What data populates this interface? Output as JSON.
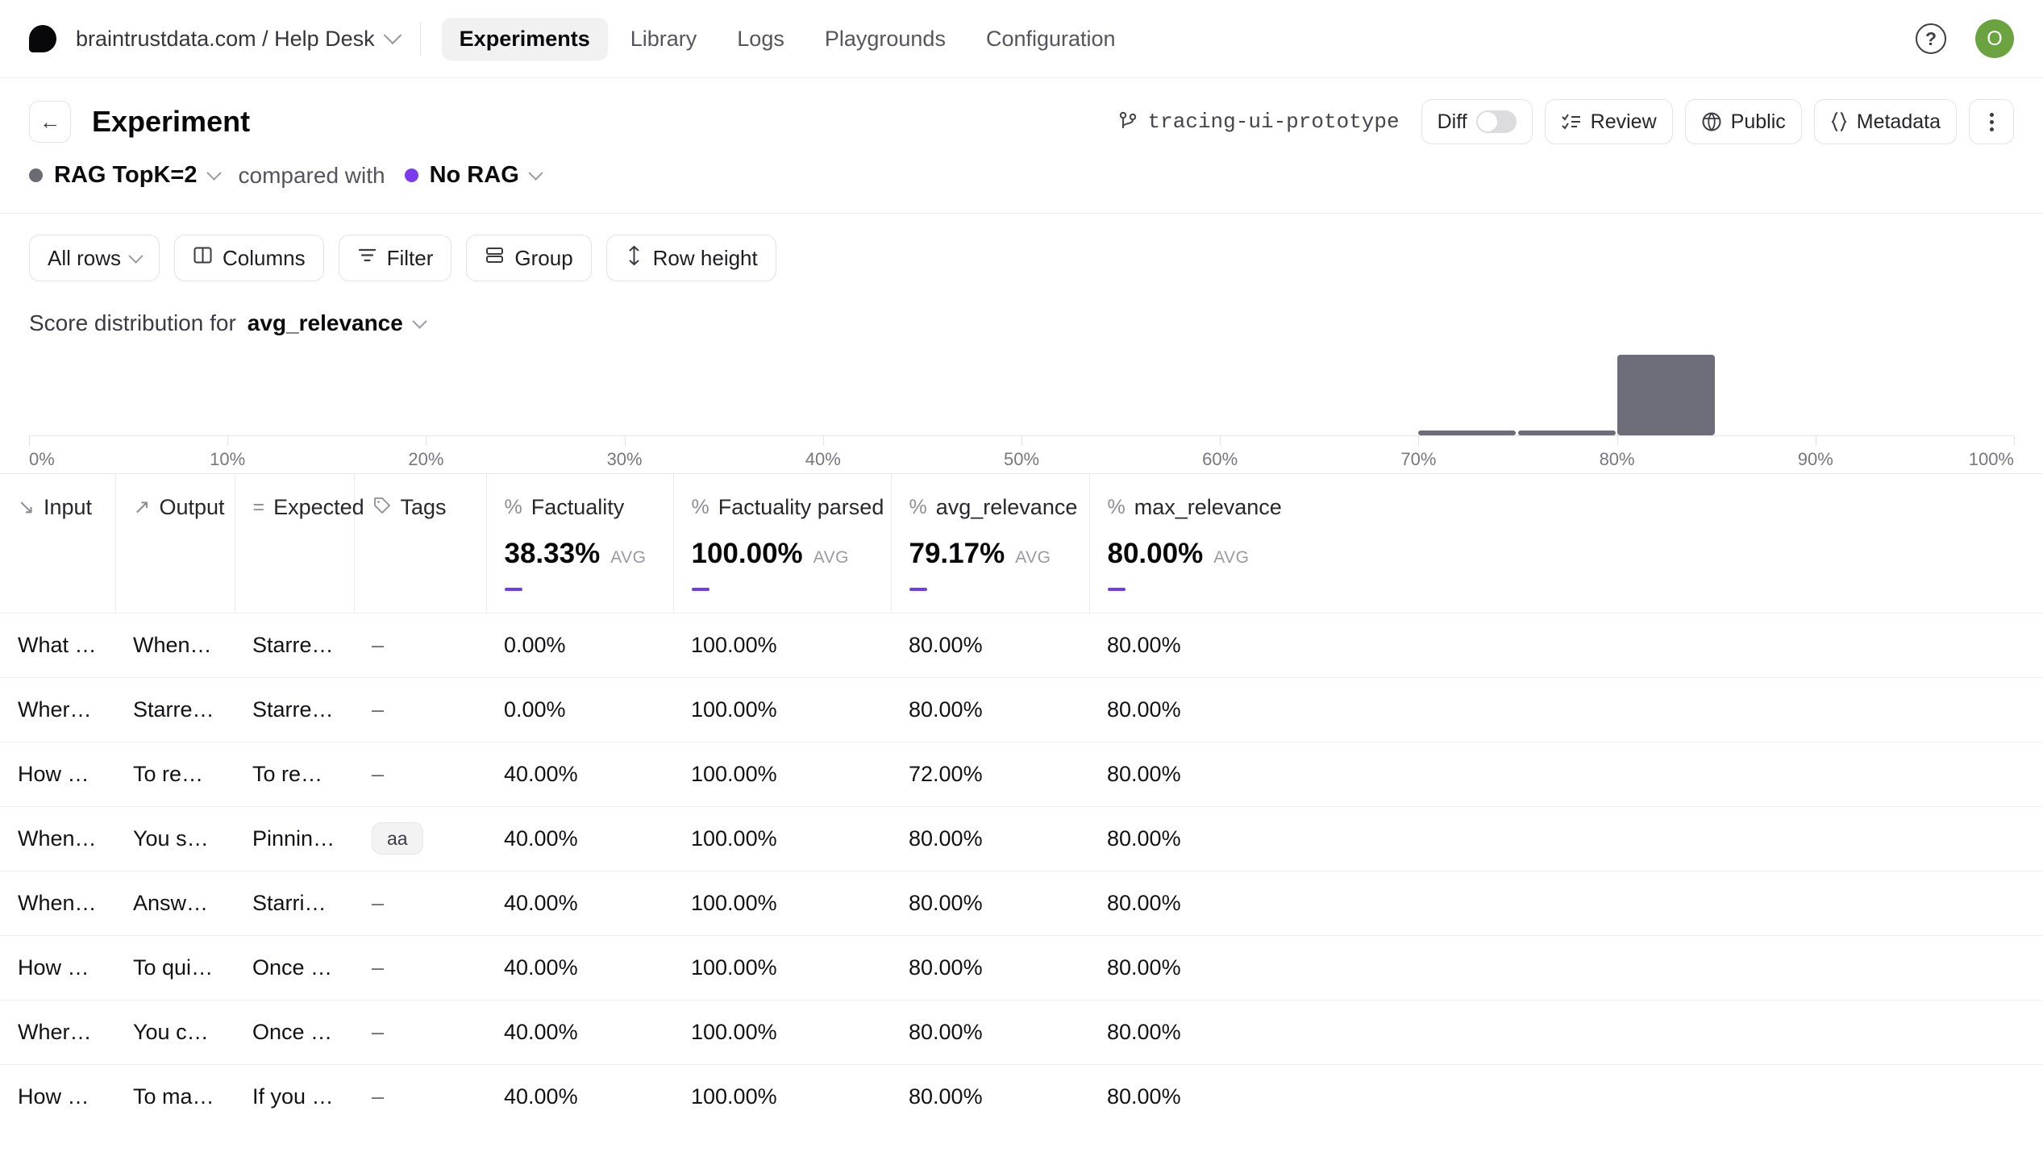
{
  "topnav": {
    "logo_icon": "braintrust-logo-icon",
    "breadcrumb": "braintrustdata.com / Help Desk",
    "breadcrumb_chevron_icon": "chevron-down-icon",
    "tabs": [
      {
        "label": "Experiments",
        "active": true
      },
      {
        "label": "Library",
        "active": false
      },
      {
        "label": "Logs",
        "active": false
      },
      {
        "label": "Playgrounds",
        "active": false
      },
      {
        "label": "Configuration",
        "active": false
      }
    ],
    "help_icon": "help-circle-icon",
    "help_glyph": "?",
    "avatar_initial": "O",
    "avatar_color": "#6aa340"
  },
  "experiment": {
    "back_icon": "arrow-left-icon",
    "back_glyph": "←",
    "title": "Experiment",
    "branch_icon": "git-branch-icon",
    "branch_name": "tracing-ui-prototype",
    "diff_label": "Diff",
    "diff_toggle_on": false,
    "review_label": "Review",
    "review_icon": "checklist-icon",
    "public_label": "Public",
    "public_icon": "globe-icon",
    "metadata_label": "Metadata",
    "metadata_icon": "braces-icon",
    "more_icon": "more-vertical-icon"
  },
  "compare": {
    "base_name": "RAG TopK=2",
    "base_color": "#6b6b74",
    "base_chevron_icon": "chevron-down-icon",
    "connector": "compared with",
    "other_name": "No RAG",
    "other_color": "#7c3aed",
    "other_chevron_icon": "chevron-down-icon"
  },
  "filterbar": {
    "buttons": [
      {
        "label": "All rows",
        "icon": "chevron-down-icon",
        "icon_side": "right"
      },
      {
        "label": "Columns",
        "icon": "columns-icon",
        "icon_side": "left"
      },
      {
        "label": "Filter",
        "icon": "filter-icon",
        "icon_side": "left"
      },
      {
        "label": "Group",
        "icon": "group-rows-icon",
        "icon_side": "left"
      },
      {
        "label": "Row height",
        "icon": "row-height-icon",
        "icon_side": "left"
      }
    ]
  },
  "distribution": {
    "label": "Score distribution for",
    "metric": "avg_relevance",
    "chevron_icon": "chevron-down-icon"
  },
  "chart_data": {
    "type": "bar",
    "title": "Score distribution for avg_relevance",
    "xlabel": "",
    "ylabel": "",
    "xlim": [
      0,
      100
    ],
    "ylim": [
      0,
      100
    ],
    "grid": false,
    "legend": null,
    "bar_color": "#6d6d79",
    "tick_labels": [
      "0%",
      "10%",
      "20%",
      "30%",
      "40%",
      "50%",
      "60%",
      "70%",
      "80%",
      "90%",
      "100%"
    ],
    "tick_values": [
      0,
      10,
      20,
      30,
      40,
      50,
      60,
      70,
      80,
      90,
      100
    ],
    "bins": [
      {
        "x0": 70,
        "x1": 75,
        "value": 4
      },
      {
        "x0": 75,
        "x1": 80,
        "value": 4
      },
      {
        "x0": 80,
        "x1": 85,
        "value": 100
      }
    ]
  },
  "table": {
    "columns": [
      {
        "name": "Input",
        "icon": "arrow-down-right-icon",
        "glyph": "↘",
        "metric": false
      },
      {
        "name": "Output",
        "icon": "arrow-up-right-icon",
        "glyph": "↗",
        "metric": false
      },
      {
        "name": "Expected",
        "icon": "equals-icon",
        "glyph": "=",
        "metric": false
      },
      {
        "name": "Tags",
        "icon": "tag-icon",
        "glyph": "⬡",
        "metric": false
      },
      {
        "name": "Factuality",
        "icon": "percent-icon",
        "glyph": "%",
        "metric": true,
        "value": "38.33%",
        "agg": "AVG"
      },
      {
        "name": "Factuality parsed",
        "icon": "percent-icon",
        "glyph": "%",
        "metric": true,
        "value": "100.00%",
        "agg": "AVG"
      },
      {
        "name": "avg_relevance",
        "icon": "percent-icon",
        "glyph": "%",
        "metric": true,
        "value": "79.17%",
        "agg": "AVG"
      },
      {
        "name": "max_relevance",
        "icon": "percent-icon",
        "glyph": "%",
        "metric": true,
        "value": "80.00%",
        "agg": "AVG"
      }
    ],
    "rows": [
      {
        "input": "What happens...",
        "output": "When you star...",
        "expected": "Starred docs ...",
        "tags": "–",
        "tag_chip": false,
        "factuality": "0.00%",
        "factuality_parsed": "100.00%",
        "avg_relevance": "80.00%",
        "max_relevance": "80.00%"
      },
      {
        "input": "Where do star...",
        "output": "Starred docs ...",
        "expected": "Starred docs ...",
        "tags": "–",
        "tag_chip": false,
        "factuality": "0.00%",
        "factuality_parsed": "100.00%",
        "avg_relevance": "80.00%",
        "max_relevance": "80.00%"
      },
      {
        "input": "How do I remo...",
        "output": "To remove a d...",
        "expected": "To remove a d...",
        "tags": "–",
        "tag_chip": false,
        "factuality": "40.00%",
        "factuality_parsed": "100.00%",
        "avg_relevance": "72.00%",
        "max_relevance": "80.00%"
      },
      {
        "input": "When should I...",
        "output": "You should pi...",
        "expected": "Pinning is rec...",
        "tags": "aa",
        "tag_chip": true,
        "factuality": "40.00%",
        "factuality_parsed": "100.00%",
        "avg_relevance": "80.00%",
        "max_relevance": "80.00%"
      },
      {
        "input": "When should I...",
        "output": "Answer: You s...",
        "expected": "Starring docs ...",
        "tags": "–",
        "tag_chip": false,
        "factuality": "40.00%",
        "factuality_parsed": "100.00%",
        "avg_relevance": "80.00%",
        "max_relevance": "80.00%"
      },
      {
        "input": "How do I quic...",
        "output": "To quickly fin...",
        "expected": "Once you star ...",
        "tags": "–",
        "tag_chip": false,
        "factuality": "40.00%",
        "factuality_parsed": "100.00%",
        "avg_relevance": "80.00%",
        "max_relevance": "80.00%"
      },
      {
        "input": "Where can I a...",
        "output": "You can acce...",
        "expected": "Once you star ...",
        "tags": "–",
        "tag_chip": false,
        "factuality": "40.00%",
        "factuality_parsed": "100.00%",
        "avg_relevance": "80.00%",
        "max_relevance": "80.00%"
      },
      {
        "input": "How can I ma...",
        "output": "To make short...",
        "expected": "If you want to ...",
        "tags": "–",
        "tag_chip": false,
        "factuality": "40.00%",
        "factuality_parsed": "100.00%",
        "avg_relevance": "80.00%",
        "max_relevance": "80.00%"
      }
    ]
  }
}
